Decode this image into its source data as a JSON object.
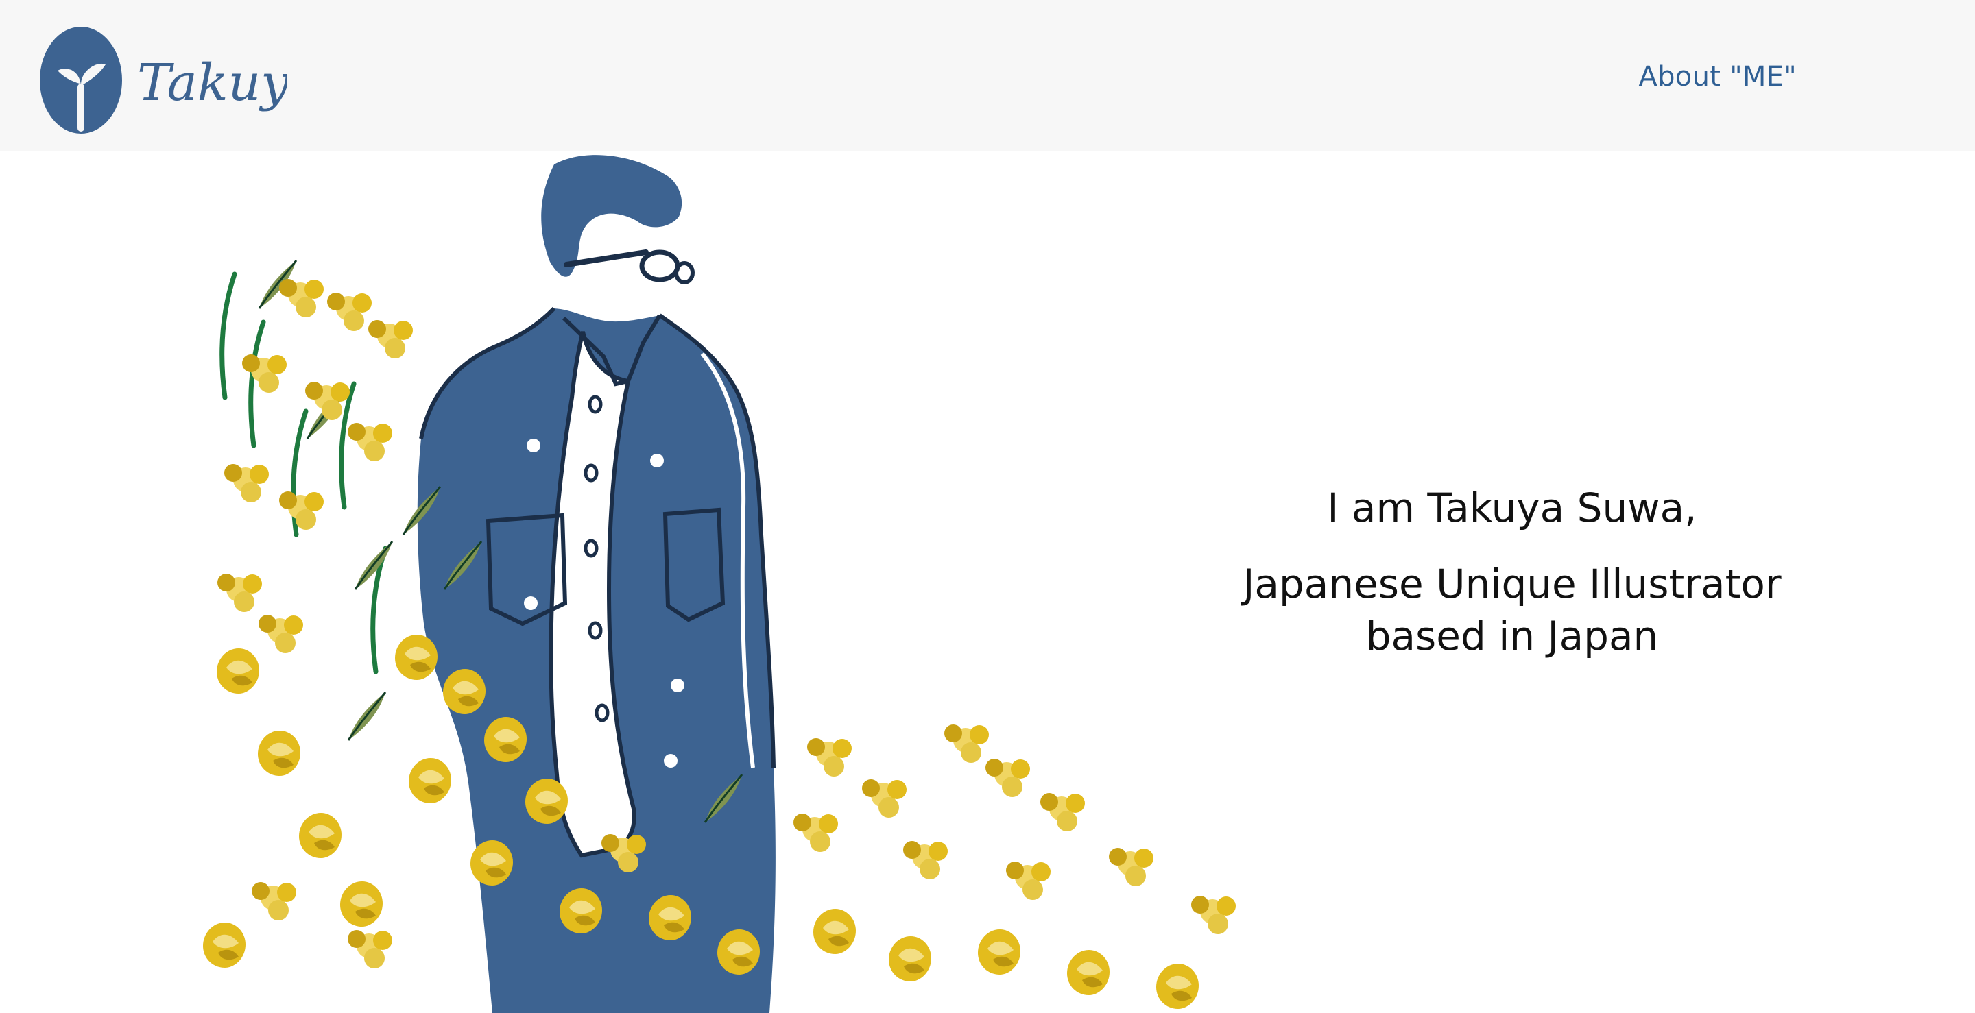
{
  "header": {
    "logo_text": "Takuya",
    "nav": {
      "about_label": "About \"ME\""
    }
  },
  "hero": {
    "intro_line1": "I am Takuya Suwa,",
    "intro_line2": "Japanese Unique Illustrator",
    "intro_line3": "based in Japan"
  },
  "colors": {
    "brand_blue": "#3d6391",
    "header_bg": "#f7f7f7",
    "flower_yellow": "#e3bc1d",
    "flower_dark_yellow": "#b9940f",
    "leaf_green": "#1f6a3a"
  },
  "icons": {
    "logo": "sprout-in-circle-icon"
  }
}
